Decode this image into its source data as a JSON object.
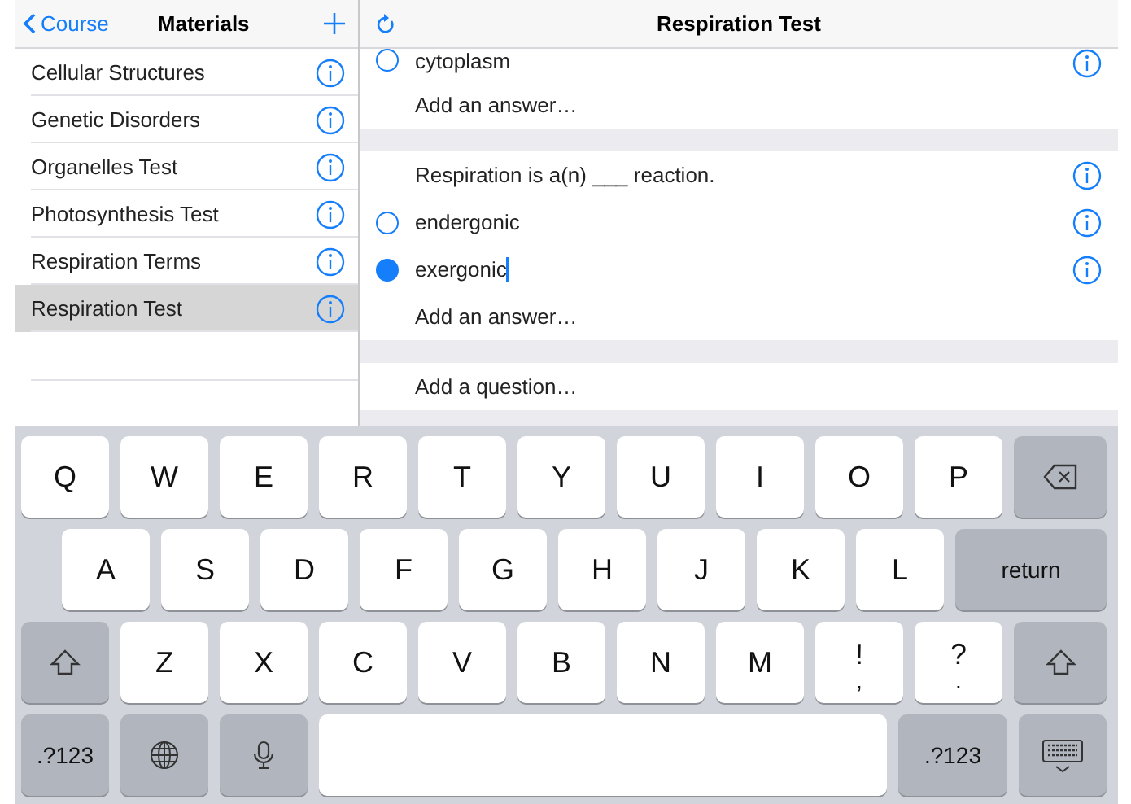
{
  "sidebar": {
    "back": "Course",
    "title": "Materials",
    "items": [
      {
        "label": "Cellular Structures",
        "selected": false
      },
      {
        "label": "Genetic Disorders",
        "selected": false
      },
      {
        "label": "Organelles Test",
        "selected": false
      },
      {
        "label": "Photosynthesis Test",
        "selected": false
      },
      {
        "label": "Respiration Terms",
        "selected": false
      },
      {
        "label": "Respiration Test",
        "selected": true
      }
    ]
  },
  "detail": {
    "title": "Respiration Test",
    "rows": [
      {
        "kind": "answer",
        "text": "cytoplasm",
        "selected": false,
        "editing": false
      },
      {
        "kind": "add",
        "text": "Add an answer…"
      },
      {
        "kind": "gap"
      },
      {
        "kind": "question",
        "text": "Respiration is a(n) ___ reaction."
      },
      {
        "kind": "answer",
        "text": "endergonic",
        "selected": false,
        "editing": false
      },
      {
        "kind": "answer",
        "text": "exergonic",
        "selected": true,
        "editing": true
      },
      {
        "kind": "add",
        "text": "Add an answer…"
      },
      {
        "kind": "gap"
      },
      {
        "kind": "add",
        "text": "Add a question…"
      },
      {
        "kind": "gap"
      }
    ]
  },
  "keyboard": {
    "rows": [
      [
        {
          "kind": "letter",
          "label": "Q"
        },
        {
          "kind": "letter",
          "label": "W"
        },
        {
          "kind": "letter",
          "label": "E"
        },
        {
          "kind": "letter",
          "label": "R"
        },
        {
          "kind": "letter",
          "label": "T"
        },
        {
          "kind": "letter",
          "label": "Y"
        },
        {
          "kind": "letter",
          "label": "U"
        },
        {
          "kind": "letter",
          "label": "I"
        },
        {
          "kind": "letter",
          "label": "O"
        },
        {
          "kind": "letter",
          "label": "P"
        },
        {
          "kind": "delete"
        }
      ],
      [
        {
          "kind": "letter",
          "label": "A"
        },
        {
          "kind": "letter",
          "label": "S"
        },
        {
          "kind": "letter",
          "label": "D"
        },
        {
          "kind": "letter",
          "label": "F"
        },
        {
          "kind": "letter",
          "label": "G"
        },
        {
          "kind": "letter",
          "label": "H"
        },
        {
          "kind": "letter",
          "label": "J"
        },
        {
          "kind": "letter",
          "label": "K"
        },
        {
          "kind": "letter",
          "label": "L"
        },
        {
          "kind": "return",
          "label": "return"
        }
      ],
      [
        {
          "kind": "shift"
        },
        {
          "kind": "letter",
          "label": "Z"
        },
        {
          "kind": "letter",
          "label": "X"
        },
        {
          "kind": "letter",
          "label": "C"
        },
        {
          "kind": "letter",
          "label": "V"
        },
        {
          "kind": "letter",
          "label": "B"
        },
        {
          "kind": "letter",
          "label": "N"
        },
        {
          "kind": "letter",
          "label": "M"
        },
        {
          "kind": "punct",
          "label": "!",
          "sub": ","
        },
        {
          "kind": "punct",
          "label": "?",
          "sub": "."
        },
        {
          "kind": "shift"
        }
      ]
    ],
    "bottom_bar": [
      {
        "kind": "mode",
        "label": ".?123"
      },
      {
        "kind": "globe"
      },
      {
        "kind": "mic"
      },
      {
        "kind": "space"
      },
      {
        "kind": "mode",
        "label": ".?123"
      },
      {
        "kind": "dismiss"
      }
    ]
  }
}
